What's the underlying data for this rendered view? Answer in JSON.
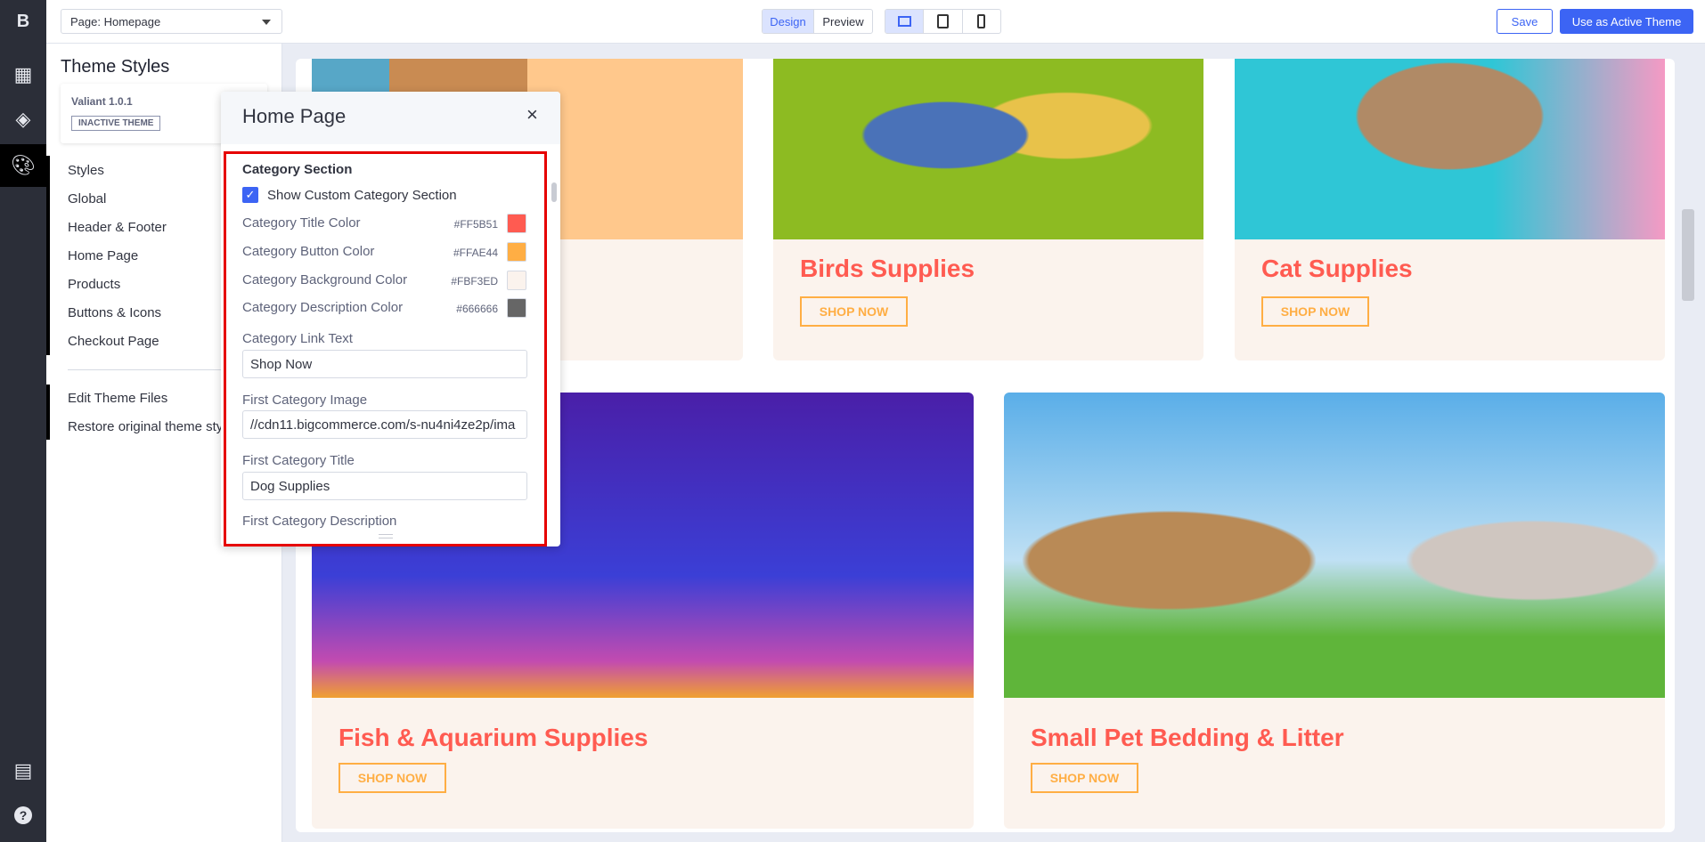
{
  "rail": {
    "icons": [
      "bigcommerce-logo-icon",
      "dashboard-icon",
      "layers-icon",
      "palette-icon",
      "storefront-icon",
      "help-icon"
    ]
  },
  "topbar": {
    "page_select": "Page: Homepage",
    "design": "Design",
    "preview": "Preview",
    "devices": [
      "desktop-icon",
      "tablet-icon",
      "mobile-icon"
    ],
    "save": "Save",
    "activate": "Use as Active Theme"
  },
  "sidebar": {
    "title": "Theme Styles",
    "theme_name": "Valiant 1.0.1",
    "theme_badge": "INACTIVE THEME",
    "items": [
      "Styles",
      "Global",
      "Header & Footer",
      "Home Page",
      "Products",
      "Buttons & Icons",
      "Checkout Page"
    ],
    "footer_items": [
      "Edit Theme Files",
      "Restore original theme sty"
    ]
  },
  "modal": {
    "title": "Home Page",
    "section": "Category Section",
    "show_custom": "Show Custom Category Section",
    "show_custom_checked": true,
    "colors": [
      {
        "label": "Category Title Color",
        "hex": "#FF5B51"
      },
      {
        "label": "Category Button Color",
        "hex": "#FFAE44"
      },
      {
        "label": "Category Background Color",
        "hex": "#FBF3ED"
      },
      {
        "label": "Category Description Color",
        "hex": "#666666"
      }
    ],
    "link_text_label": "Category Link Text",
    "link_text": "Shop Now",
    "first_image_label": "First Category Image",
    "first_image": "//cdn11.bigcommerce.com/s-nu4ni4ze2p/ima",
    "first_title_label": "First Category Title",
    "first_title": "Dog Supplies",
    "first_desc_label": "First Category Description"
  },
  "preview": {
    "cards": [
      {
        "title": "",
        "button": ""
      },
      {
        "title": "Birds Supplies",
        "button": "SHOP NOW"
      },
      {
        "title": "Cat Supplies",
        "button": "SHOP NOW"
      },
      {
        "title": "Fish & Aquarium Supplies",
        "button": "SHOP NOW"
      },
      {
        "title": "Small Pet Bedding & Litter",
        "button": "SHOP NOW"
      }
    ]
  }
}
